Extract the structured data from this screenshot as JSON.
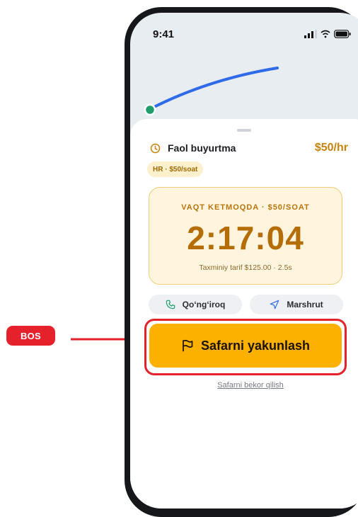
{
  "annotation": {
    "badge": "BOS"
  },
  "statusbar": {
    "time": "9:41"
  },
  "order": {
    "title": "Faol buyurtma",
    "price": "$50/hr",
    "chip": "HR · $50/soat"
  },
  "timer": {
    "label": "VAQT KETMOQDA · $50/SOAT",
    "value": "2:17:04",
    "estimate": "Taxminiy tarif $125.00 · 2.5s"
  },
  "actions": {
    "call_label": "Qo‘ng‘iroq",
    "route_label": "Marshrut",
    "end_label": "Safarni yakunlash",
    "cancel_label": "Safarni bekor qilish"
  },
  "colors": {
    "accent": "#fcb100",
    "price": "#c8830c",
    "annotation_red": "#e5222b",
    "route_line": "#2f6be8",
    "start_dot": "#1f9d6b"
  },
  "icons": [
    "clock-icon",
    "phone-icon",
    "navigation-icon",
    "flag-icon",
    "signal-icon",
    "wifi-icon",
    "battery-icon"
  ]
}
